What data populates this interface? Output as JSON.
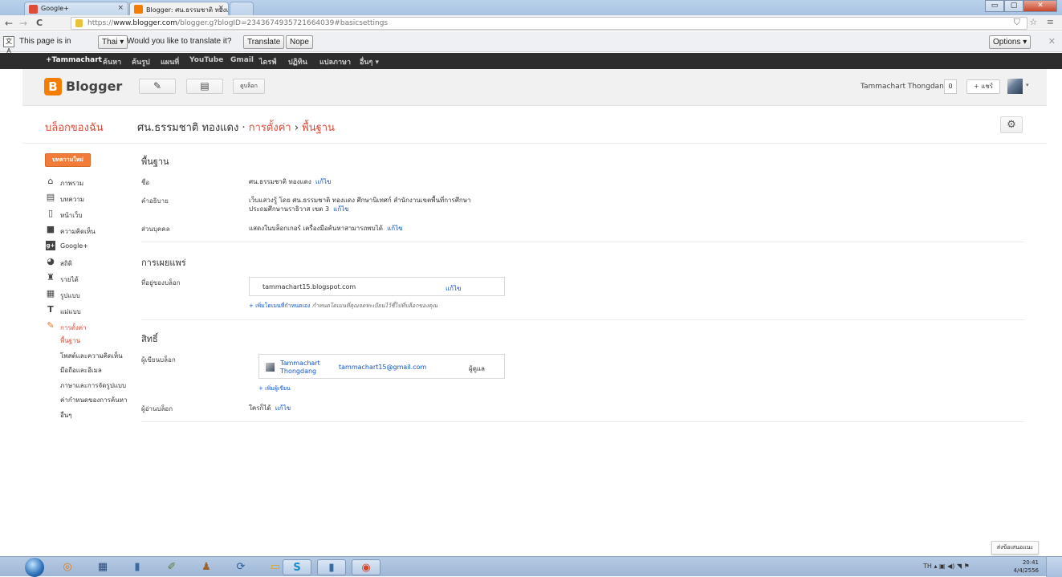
{
  "browser": {
    "tabs": [
      {
        "title": "Google+",
        "close": "×",
        "favicon_color": "#dd4b39"
      },
      {
        "title": "Blogger: ศน.ธรรมชาติ ทองแ",
        "close": "×",
        "favicon_color": "#f57d00"
      }
    ],
    "window_buttons": {
      "minimize": "▭",
      "maximize": "▢",
      "close": "✕"
    },
    "nav": {
      "back": "←",
      "forward": "→",
      "reload": "C"
    },
    "url": {
      "scheme": "https://",
      "host": "www.blogger.com",
      "path": "/blogger.g?blogID=2343674935721664039#basicsettings"
    },
    "toolbar_icons": "⛉ ☆ ≡"
  },
  "translate_bar": {
    "prefix": "This page is in",
    "language": "Thai ▾",
    "question": "Would you like to translate it?",
    "translate": "Translate",
    "nope": "Nope",
    "options": "Options ▾",
    "close": "✕"
  },
  "google_bar": {
    "items": [
      "+Tammachart",
      "ค้นหา",
      "ค้นรูป",
      "แผนที่",
      "YouTube",
      "Gmail",
      "ไดรฟ์",
      "ปฏิทิน",
      "แปลภาษา",
      "อื่นๆ ▾"
    ]
  },
  "blogger_header": {
    "logo_letter": "B",
    "brand": "Blogger",
    "edit_icon": "✎",
    "posts_icon": "▤",
    "view_blog": "ดูบล็อก",
    "user_name": "Tammachart Thongdang",
    "count": "0",
    "share": "+ แชร์",
    "caret": "▾"
  },
  "title_bar": {
    "my_blogs": "บล็อกของฉัน",
    "blog_name": "ศน.ธรรมชาติ ทองแดง",
    "sep1": " · ",
    "settings": "การตั้งค่า",
    "sep2": " › ",
    "basic": "พื้นฐาน",
    "gear": "⚙"
  },
  "sidebar": {
    "new_post": "บทความใหม่",
    "items": [
      {
        "icon": "⌂",
        "label": "ภาพรวม"
      },
      {
        "icon": "▤",
        "label": "บทความ"
      },
      {
        "icon": "▯",
        "label": "หน้าเว็บ"
      },
      {
        "icon": "■",
        "label": "ความคิดเห็น"
      },
      {
        "icon": "g+",
        "label": "Google+"
      },
      {
        "icon": "◕",
        "label": "สถิติ"
      },
      {
        "icon": "♜",
        "label": "รายได้"
      },
      {
        "icon": "▦",
        "label": "รูปแบบ"
      },
      {
        "icon": "T",
        "label": "แม่แบบ"
      },
      {
        "icon": "✎",
        "label": "การตั้งค่า"
      }
    ],
    "sub_items": [
      "พื้นฐาน",
      "โพสต์และความคิดเห็น",
      "มือถือและอีเมล",
      "ภาษาและการจัดรูปแบบ",
      "ค่ากำหนดของการค้นหา",
      "อื่นๆ"
    ]
  },
  "basics": {
    "title": "พื้นฐาน",
    "name_label": "ชื่อ",
    "name_value": "ศน.ธรรมชาติ ทองแดง",
    "edit": "แก้ไข",
    "desc_label": "คำอธิบาย",
    "desc_line1": "เว็บแสวงรู้ โดย ศน.ธรรมชาติ ทองแดง ศึกษานิเทศก์ สำนักงานเขตพื้นที่การศึกษา",
    "desc_line2": "ประถมศึกษานราธิวาส เขต 3",
    "privacy_label": "ส่วนบุคคล",
    "privacy_value": "แสดงในบล็อกเกอร์ เครื่องมือค้นหาสามารถพบได้"
  },
  "publishing": {
    "title": "การเผยแพร่",
    "address_label": "ที่อยู่ของบล็อก",
    "address": "tammachart15.blogspot.com",
    "edit": "แก้ไข",
    "add_domain": "+ เพิ่มโดเมนที่กำหนดเอง",
    "domain_hint": "กำหนดโดเมนที่คุณจดทะเบียนไว้ชี้ไปที่บล็อกของคุณ"
  },
  "permissions": {
    "title": "สิทธิ์",
    "authors_label": "ผู้เขียนบล็อก",
    "author_name_1": "Tammachart",
    "author_name_2": "Thongdang",
    "author_email": "tammachart15@gmail.com",
    "author_role": "ผู้ดูแล",
    "add_author": "+ เพิ่มผู้เขียน",
    "readers_label": "ผู้อ่านบล็อก",
    "readers_value": "ใครก็ได้",
    "edit": "แก้ไข"
  },
  "feedback": "ส่งข้อเสนอแนะ",
  "taskbar": {
    "apps": [
      {
        "icon": "◎"
      },
      {
        "icon": "▦"
      },
      {
        "icon": "▮"
      },
      {
        "icon": "✐"
      },
      {
        "icon": "♟"
      },
      {
        "icon": "⟳"
      },
      {
        "icon": "▭"
      },
      {
        "icon": "S"
      },
      {
        "icon": "▮"
      },
      {
        "icon": "◉"
      }
    ],
    "tray": "TH  ▴  ▣ ◀) ◥ ⚑",
    "time": "20:41",
    "date": "4/4/2556"
  }
}
